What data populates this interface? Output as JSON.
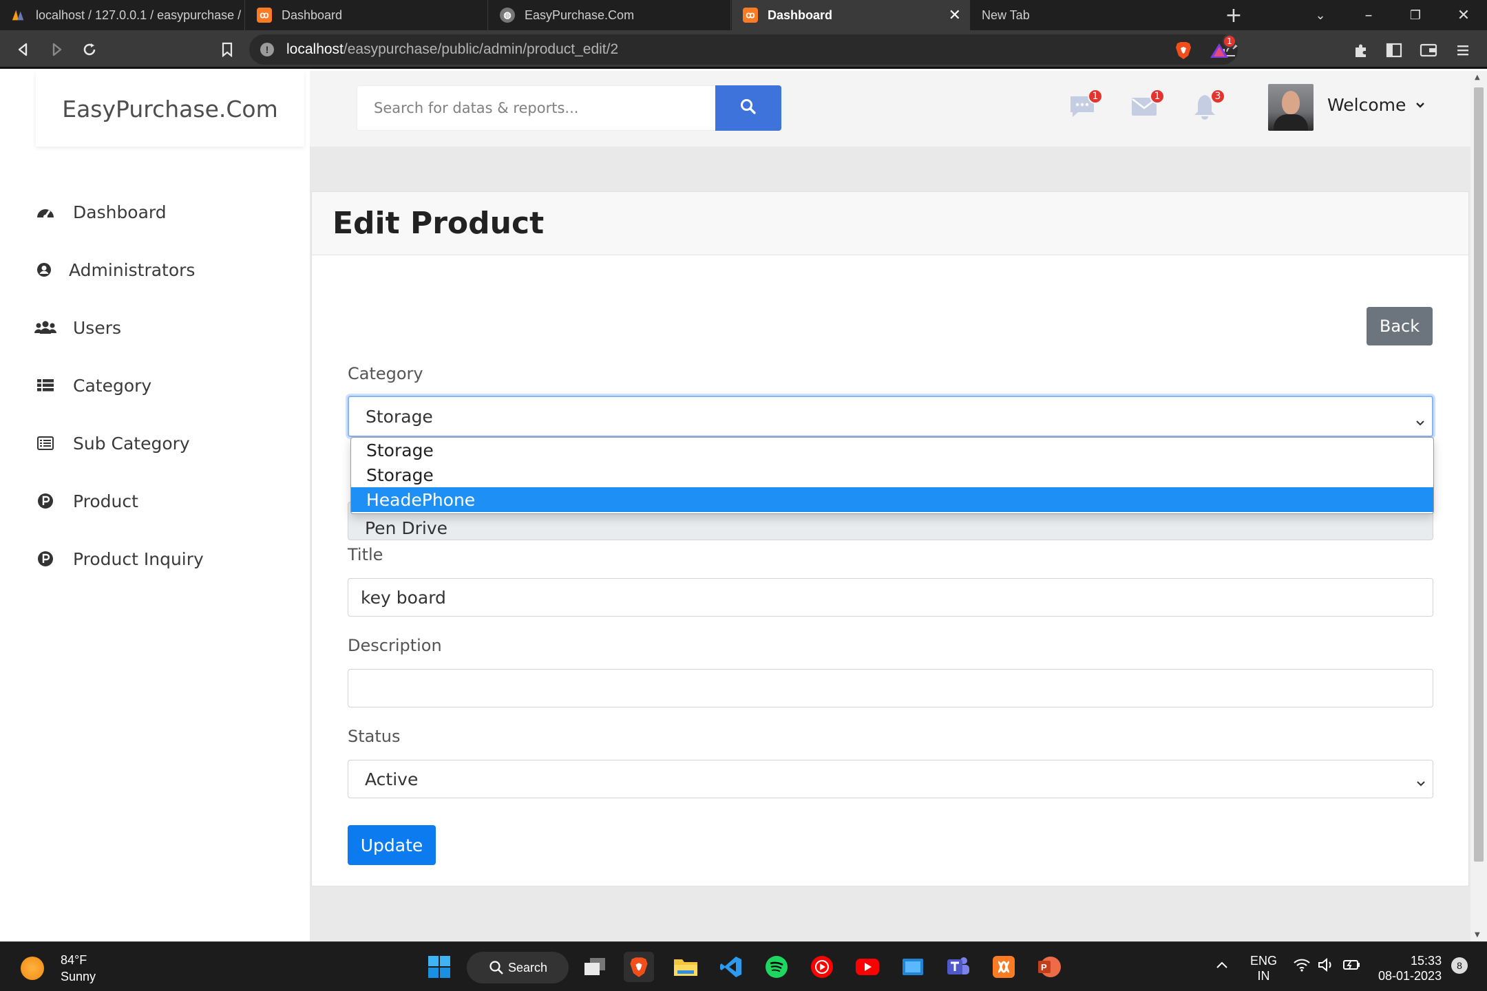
{
  "browser": {
    "tabs": [
      {
        "label": "localhost / 127.0.0.1 / easypurchase /",
        "favicon": "phpmyadmin-icon",
        "active": false
      },
      {
        "label": "Dashboard",
        "favicon": "xampp-icon",
        "active": false
      },
      {
        "label": "EasyPurchase.Com",
        "favicon": "globe-icon",
        "active": false
      },
      {
        "label": "Dashboard",
        "favicon": "xampp-icon",
        "active": true
      },
      {
        "label": "New Tab",
        "favicon": "",
        "active": false
      }
    ],
    "url_host": "localhost",
    "url_path": "/easypurchase/public/admin/product_edit/2",
    "extension_badge": "1"
  },
  "sidebar": {
    "brand": "EasyPurchase.Com",
    "items": [
      {
        "label": "Dashboard",
        "icon": "tachometer-icon"
      },
      {
        "label": "Administrators",
        "icon": "user-circle-icon"
      },
      {
        "label": "Users",
        "icon": "users-icon"
      },
      {
        "label": "Category",
        "icon": "list-icon"
      },
      {
        "label": "Sub Category",
        "icon": "list-alt-icon"
      },
      {
        "label": "Product",
        "icon": "product-p-icon"
      },
      {
        "label": "Product Inquiry",
        "icon": "product-p-icon"
      }
    ]
  },
  "topbar": {
    "search_placeholder": "Search for datas & reports...",
    "messages_count": "1",
    "mail_count": "1",
    "notifications_count": "3",
    "welcome": "Welcome"
  },
  "form": {
    "title": "Edit Product",
    "back_label": "Back",
    "category_label": "Category",
    "category_value": "Storage",
    "category_options": [
      "Storage",
      "Storage",
      "HeadePhone"
    ],
    "category_highlighted": "HeadePhone",
    "subcategory_value": "Pen Drive",
    "title_label": "Title",
    "title_value": "key board",
    "description_label": "Description",
    "description_value": "",
    "status_label": "Status",
    "status_value": "Active",
    "update_label": "Update"
  },
  "taskbar": {
    "weather_temp": "84°F",
    "weather_desc": "Sunny",
    "search_label": "Search",
    "lang_top": "ENG",
    "lang_bottom": "IN",
    "time": "15:33",
    "date": "08-01-2023",
    "notification_count": "8"
  },
  "colors": {
    "primary_button": "#0d7bf0",
    "search_button": "#3f73dc",
    "back_button": "#6c757d",
    "dropdown_highlight": "#1e8ff5",
    "badge": "#e3342f"
  }
}
